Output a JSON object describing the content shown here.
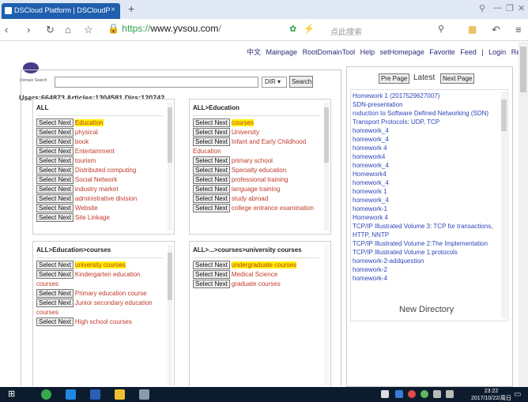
{
  "browser": {
    "tab_title": "DSCloud Platform | DSCloudP",
    "tab_close": "×",
    "new_tab": "+",
    "url_scheme": "https://",
    "url_host": "www.yvsou.com",
    "url_path": "/",
    "search_placeholder": "点此搜索"
  },
  "topnav": {
    "items": [
      "中文",
      "Mainpage",
      "RootDomainTool",
      "Help",
      "setHomepage",
      "Favorite",
      "Feed",
      "|",
      "Login",
      "Register"
    ]
  },
  "logo": {
    "caption": "Domain Search"
  },
  "stats": "Users:664873 Articles:1304581 Dirs:120742",
  "search": {
    "dir_value": "DIR",
    "button": "Search"
  },
  "select_label": "Select Next",
  "panels": [
    {
      "title": "ALL",
      "rows": [
        {
          "text": "Education",
          "selected": true
        },
        {
          "text": "physical"
        },
        {
          "text": "book"
        },
        {
          "text": "Entertainment"
        },
        {
          "text": "tourism"
        },
        {
          "text": "Distributed computing"
        },
        {
          "text": "Social Network"
        },
        {
          "text": "industry market"
        },
        {
          "text": "administrative division"
        },
        {
          "text": "Website"
        },
        {
          "text": "Site Linkage"
        }
      ]
    },
    {
      "title": "ALL>Education",
      "rows": [
        {
          "text": "courses",
          "selected": true
        },
        {
          "text": "University"
        },
        {
          "text": "Infant and Early Childhood Education",
          "wrap": true
        },
        {
          "text": "primary school"
        },
        {
          "text": "Specialty education"
        },
        {
          "text": "professional training"
        },
        {
          "text": "language training"
        },
        {
          "text": "study abroad"
        },
        {
          "text": "college entrance examination",
          "wrap": true
        }
      ]
    },
    {
      "title": "ALL>Education>courses",
      "rows": [
        {
          "text": "university courses",
          "selected": true
        },
        {
          "text": "Kindergarten education courses",
          "wrap": true
        },
        {
          "text": "Primary education course"
        },
        {
          "text": "Junior secondary education courses",
          "wrap": true
        },
        {
          "text": "High school courses"
        }
      ]
    },
    {
      "title": "ALL>...>courses>university courses",
      "rows": [
        {
          "text": "undergraduate courses",
          "selected": true
        },
        {
          "text": "Medical Science"
        },
        {
          "text": "graduate courses"
        }
      ]
    }
  ],
  "right": {
    "prev": "Pre Page",
    "latest": "Latest",
    "next": "Next Page",
    "items": [
      "Homework 1 (2017529627007)",
      "SDN-presentation",
      "roduction to Software Defined Networking (SDN)",
      "Transport Protocols: UDP, TCP",
      "homework_4",
      "homework_4",
      "homework 4",
      "homework4",
      "homework_4",
      "Homework4",
      "homework_4",
      "homework 1",
      "homework_4",
      "homework-1",
      "Homework 4",
      "TCP/IP Illustrated Volume 3: TCP for transactions, HTTP, NNTP",
      "TCP/IP Illustrated Volume 2:The Implementation",
      "TCP/IP Illustrated Volume 1:protocols",
      "homework-2-addquestion",
      "homework-2",
      "homework-4"
    ],
    "new_directory": "New Directory"
  },
  "taskbar": {
    "time": "23:22",
    "date": "2017/10/22/周日"
  }
}
